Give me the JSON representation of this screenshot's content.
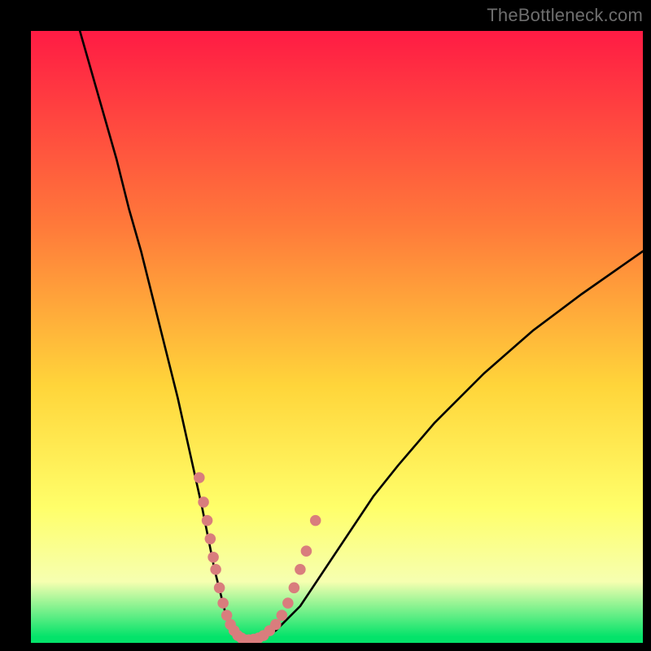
{
  "watermark": "TheBottleneck.com",
  "colors": {
    "gradient_top": "#ff1b44",
    "gradient_mid1": "#ff7a3a",
    "gradient_mid2": "#ffd53a",
    "gradient_mid3": "#ffff6a",
    "gradient_mid4": "#f6ffb0",
    "gradient_bottom": "#04e36a",
    "curve": "#000000",
    "dot": "#d97d7d",
    "frame_bg": "#000000"
  },
  "chart_data": {
    "type": "line",
    "title": "",
    "xlabel": "",
    "ylabel": "",
    "xlim": [
      0,
      100
    ],
    "ylim": [
      0,
      100
    ],
    "grid": false,
    "legend": false,
    "series": [
      {
        "name": "curve",
        "x": [
          8,
          10,
          12,
          14,
          16,
          18,
          20,
          22,
          24,
          26,
          28,
          29,
          30,
          31,
          32,
          33,
          34,
          35,
          37,
          40,
          44,
          48,
          52,
          56,
          60,
          66,
          74,
          82,
          90,
          100
        ],
        "y": [
          100,
          93,
          86,
          79,
          71,
          64,
          56,
          48,
          40,
          31,
          22,
          17,
          12,
          8,
          4,
          1.5,
          0.5,
          0,
          0.5,
          2,
          6,
          12,
          18,
          24,
          29,
          36,
          44,
          51,
          57,
          64
        ]
      }
    ],
    "dots": {
      "name": "highlighted-points",
      "x": [
        27.5,
        28.2,
        28.8,
        29.3,
        29.8,
        30.2,
        30.8,
        31.4,
        32,
        32.6,
        33.2,
        33.8,
        34.4,
        35,
        35.6,
        36.4,
        37.2,
        38,
        39,
        40,
        41,
        42,
        43,
        44,
        45,
        46.5
      ],
      "y": [
        27,
        23,
        20,
        17,
        14,
        12,
        9,
        6.5,
        4.5,
        3,
        2,
        1.2,
        0.8,
        0.5,
        0.5,
        0.6,
        0.8,
        1.2,
        2,
        3,
        4.5,
        6.5,
        9,
        12,
        15,
        20
      ]
    }
  }
}
